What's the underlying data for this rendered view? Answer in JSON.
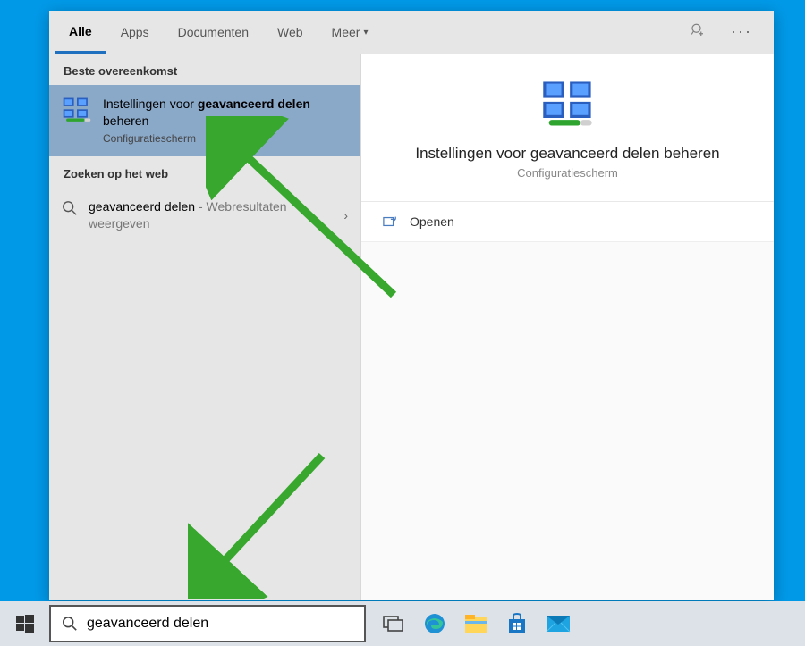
{
  "tabs": [
    "Alle",
    "Apps",
    "Documenten",
    "Web",
    "Meer"
  ],
  "active_tab": 0,
  "section_best": "Beste overeenkomst",
  "section_web": "Zoeken op het web",
  "best_match": {
    "title_prefix": "Instellingen voor ",
    "title_bold": "geavanceerd delen",
    "title_suffix": " beheren",
    "subtitle": "Configuratiescherm"
  },
  "web_result": {
    "query": "geavanceerd delen",
    "suffix": " - Webresultaten weergeven"
  },
  "detail": {
    "title": "Instellingen voor geavanceerd delen beheren",
    "subtitle": "Configuratiescherm",
    "action": "Openen"
  },
  "search_value": "geavanceerd delen",
  "colors": {
    "desktop": "#0099e8",
    "tab_accent": "#2070c0",
    "selected_bg": "#8aa8c8",
    "arrow": "#37a82d"
  }
}
